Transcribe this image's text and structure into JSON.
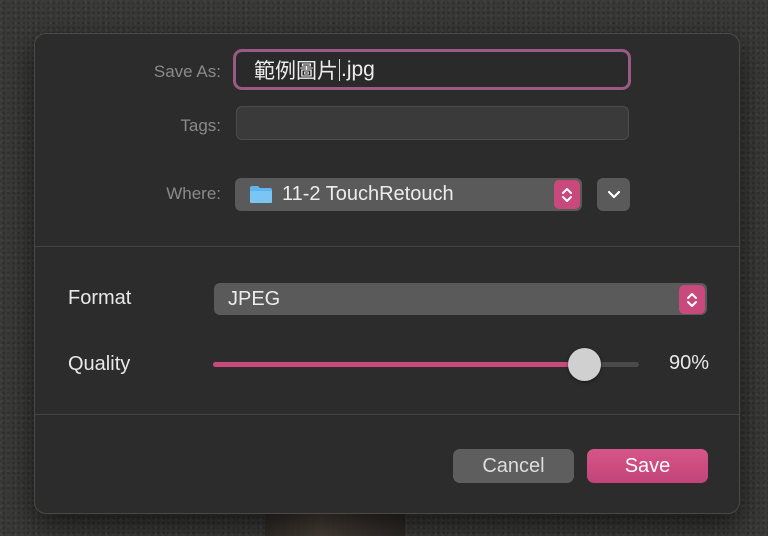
{
  "save_as": {
    "label": "Save As:",
    "value_before_caret": "範例圖片",
    "value_after_caret": ".jpg"
  },
  "tags": {
    "label": "Tags:",
    "value": ""
  },
  "where": {
    "label": "Where:",
    "value": "11-2 TouchRetouch",
    "icon": "folder-icon"
  },
  "format": {
    "label": "Format",
    "value": "JPEG"
  },
  "quality": {
    "label": "Quality",
    "value_text": "90%",
    "fraction": 0.87
  },
  "buttons": {
    "cancel": "Cancel",
    "save": "Save"
  },
  "colors": {
    "accent": "#c84a7c",
    "focus_ring": "#9a5a86",
    "dialog_bg": "#2c2c2c",
    "control_bg": "#5a5a5a"
  }
}
